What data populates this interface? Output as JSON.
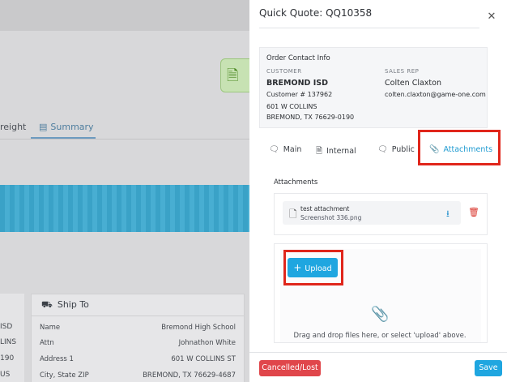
{
  "background": {
    "tabs": [
      "reight",
      "Summary"
    ],
    "ship_to": {
      "title": "Ship To",
      "rows": [
        {
          "label": "Name",
          "value": "Bremond High School"
        },
        {
          "label": "Attn",
          "value": "Johnathon White"
        },
        {
          "label": "Address 1",
          "value": "601 W COLLINS ST"
        },
        {
          "label": "City, State ZIP",
          "value": "BREMOND, TX 76629-4687"
        }
      ]
    },
    "left_cells": [
      "ISD",
      "LINS",
      "190",
      "US"
    ]
  },
  "modal": {
    "title": "Quick Quote: QQ10358",
    "contact": {
      "heading": "Order Contact Info",
      "customer_label": "CUSTOMER",
      "customer_name": "BREMOND ISD",
      "customer_number": "Customer # 137962",
      "address_line1": "601 W COLLINS",
      "address_line2": "BREMOND, TX 76629-0190",
      "rep_label": "SALES REP",
      "rep_name": "Colten Claxton",
      "rep_email": "colten.claxton@game-one.com"
    },
    "tabs": [
      {
        "label": "Main",
        "icon": "chat-bubble-icon"
      },
      {
        "label": "Internal",
        "icon": "document-icon"
      },
      {
        "label": "Public",
        "icon": "chat-bubble-icon"
      },
      {
        "label": "Attachments",
        "icon": "paperclip-icon",
        "active": true
      }
    ],
    "attachments": {
      "label": "Attachments",
      "file_name": "test attachment",
      "file_sub": "Screenshot 336.png"
    },
    "upload_label": "Upload",
    "drop_text": "Drag and drop files here, or select 'upload' above.",
    "cancel_label": "Cancelled/Lost",
    "save_label": "Save"
  },
  "colors": {
    "accent": "#1fa6e0",
    "danger": "#e0464b",
    "highlight": "#e0261b"
  }
}
